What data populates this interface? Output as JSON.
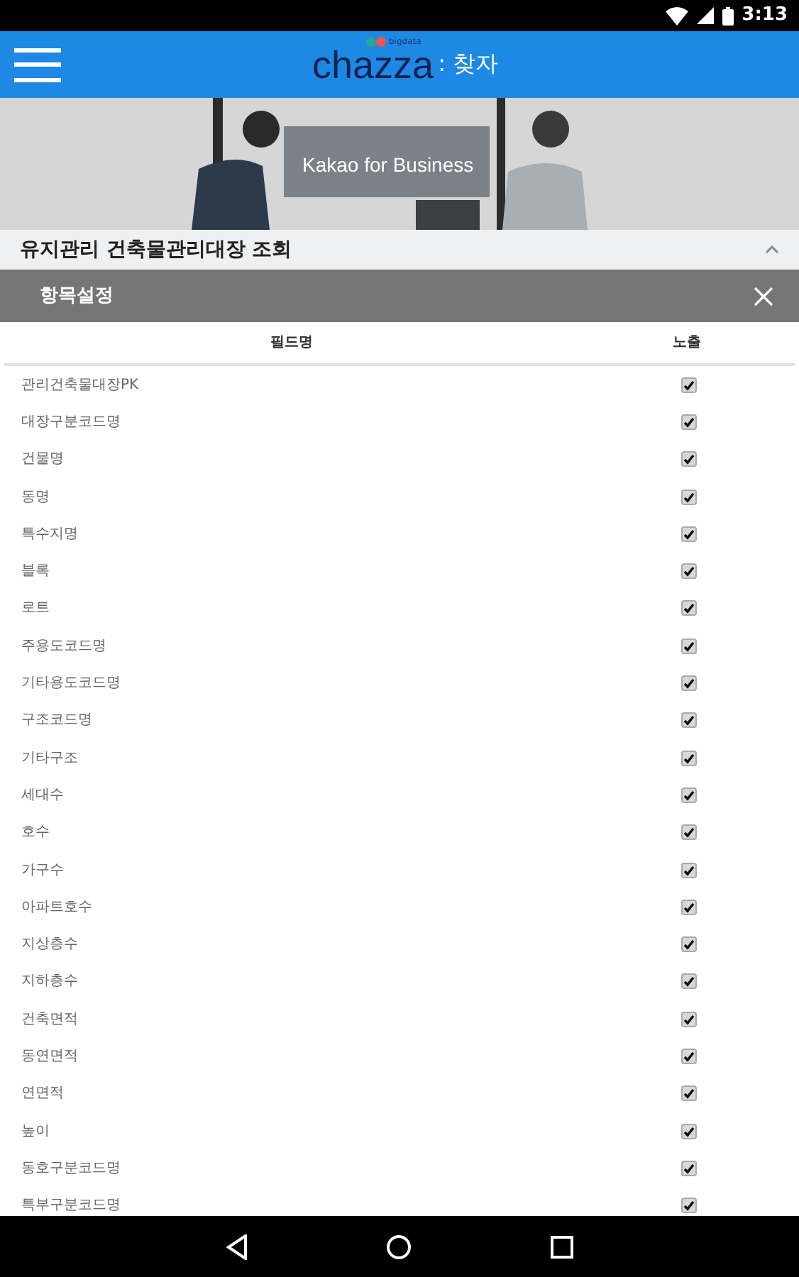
{
  "status_bar": {
    "time": "3:13"
  },
  "app_bar": {
    "logo_small": "bigdata",
    "logo": "chazza",
    "logo_suffix": ": 찾자"
  },
  "banner": {
    "caption": "Kakao for Business"
  },
  "page_title": "유지관리 건축물관리대장 조회",
  "dialog": {
    "title": "항목설정",
    "columns": [
      "필드명",
      "노출"
    ],
    "rows": [
      {
        "label": "관리건축물대장PK",
        "checked": true
      },
      {
        "label": "대장구분코드명",
        "checked": true
      },
      {
        "label": "건물명",
        "checked": true
      },
      {
        "label": "동명",
        "checked": true
      },
      {
        "label": "특수지명",
        "checked": true
      },
      {
        "label": "블록",
        "checked": true
      },
      {
        "label": "로트",
        "checked": true
      },
      {
        "label": "주용도코드명",
        "checked": true
      },
      {
        "label": "기타용도코드명",
        "checked": true
      },
      {
        "label": "구조코드명",
        "checked": true
      },
      {
        "label": "기타구조",
        "checked": true
      },
      {
        "label": "세대수",
        "checked": true
      },
      {
        "label": "호수",
        "checked": true
      },
      {
        "label": "가구수",
        "checked": true
      },
      {
        "label": "아파트호수",
        "checked": true
      },
      {
        "label": "지상층수",
        "checked": true
      },
      {
        "label": "지하층수",
        "checked": true
      },
      {
        "label": "건축면적",
        "checked": true
      },
      {
        "label": "동연면적",
        "checked": true
      },
      {
        "label": "연면적",
        "checked": true
      },
      {
        "label": "높이",
        "checked": true
      },
      {
        "label": "동호구분코드명",
        "checked": true
      },
      {
        "label": "특부구분코드명",
        "checked": true
      }
    ]
  }
}
